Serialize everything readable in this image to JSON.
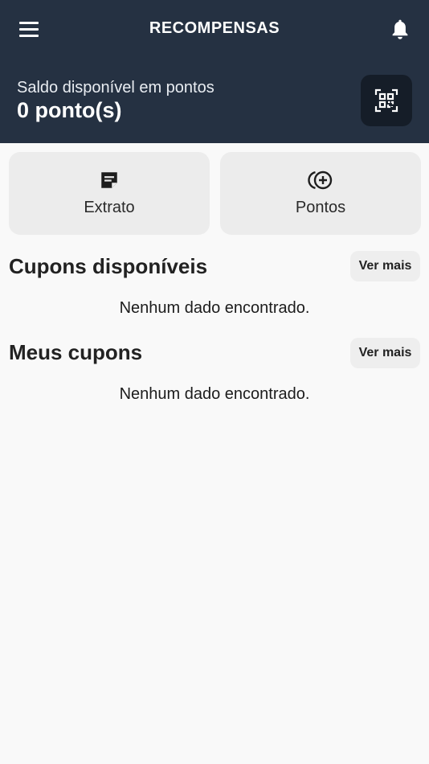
{
  "header": {
    "title": "RECOMPENSAS",
    "balance_label": "Saldo disponível em pontos",
    "balance_value": "0 ponto(s)",
    "menu_icon": "hamburger-menu-icon",
    "bell_icon": "bell-icon",
    "qr_icon": "qr-code-scan-icon"
  },
  "actions": {
    "extrato": {
      "label": "Extrato",
      "icon": "note-icon"
    },
    "pontos": {
      "label": "Pontos",
      "icon": "add-coins-icon"
    }
  },
  "sections": {
    "available_coupons": {
      "title": "Cupons disponíveis",
      "more_label": "Ver mais",
      "empty_message": "Nenhum dado encontrado."
    },
    "my_coupons": {
      "title": "Meus cupons",
      "more_label": "Ver mais",
      "empty_message": "Nenhum dado encontrado."
    }
  },
  "colors": {
    "header_bg": "#253142",
    "qr_button_bg": "#151d28",
    "page_bg": "#f9f9f9",
    "card_bg": "#ececec"
  }
}
